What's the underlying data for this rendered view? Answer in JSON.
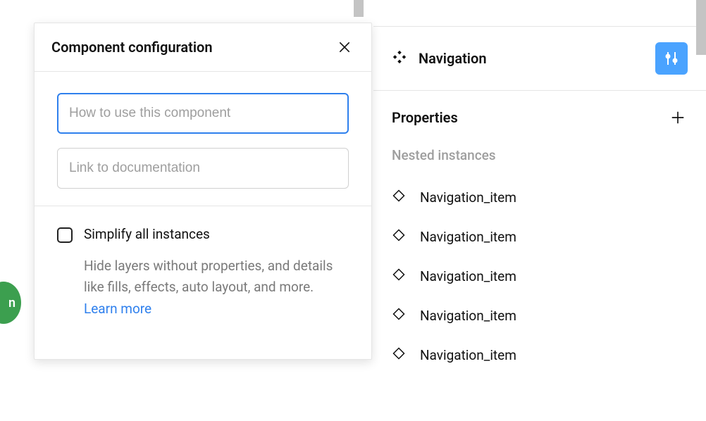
{
  "modal": {
    "title": "Component configuration",
    "input_howto_placeholder": "How to use this component",
    "input_howto_value": "",
    "input_link_placeholder": "Link to documentation",
    "input_link_value": "",
    "simplify": {
      "label": "Simplify all instances",
      "description_prefix": "Hide layers without properties, and details like fills, effects, auto layout, and more. ",
      "learn_more": "Learn more",
      "checked": false
    }
  },
  "sidebar": {
    "component_name": "Navigation",
    "properties_label": "Properties",
    "nested_label": "Nested instances",
    "instances": [
      {
        "label": "Navigation_item"
      },
      {
        "label": "Navigation_item"
      },
      {
        "label": "Navigation_item"
      },
      {
        "label": "Navigation_item"
      },
      {
        "label": "Navigation_item"
      }
    ]
  },
  "green_badge": "n"
}
